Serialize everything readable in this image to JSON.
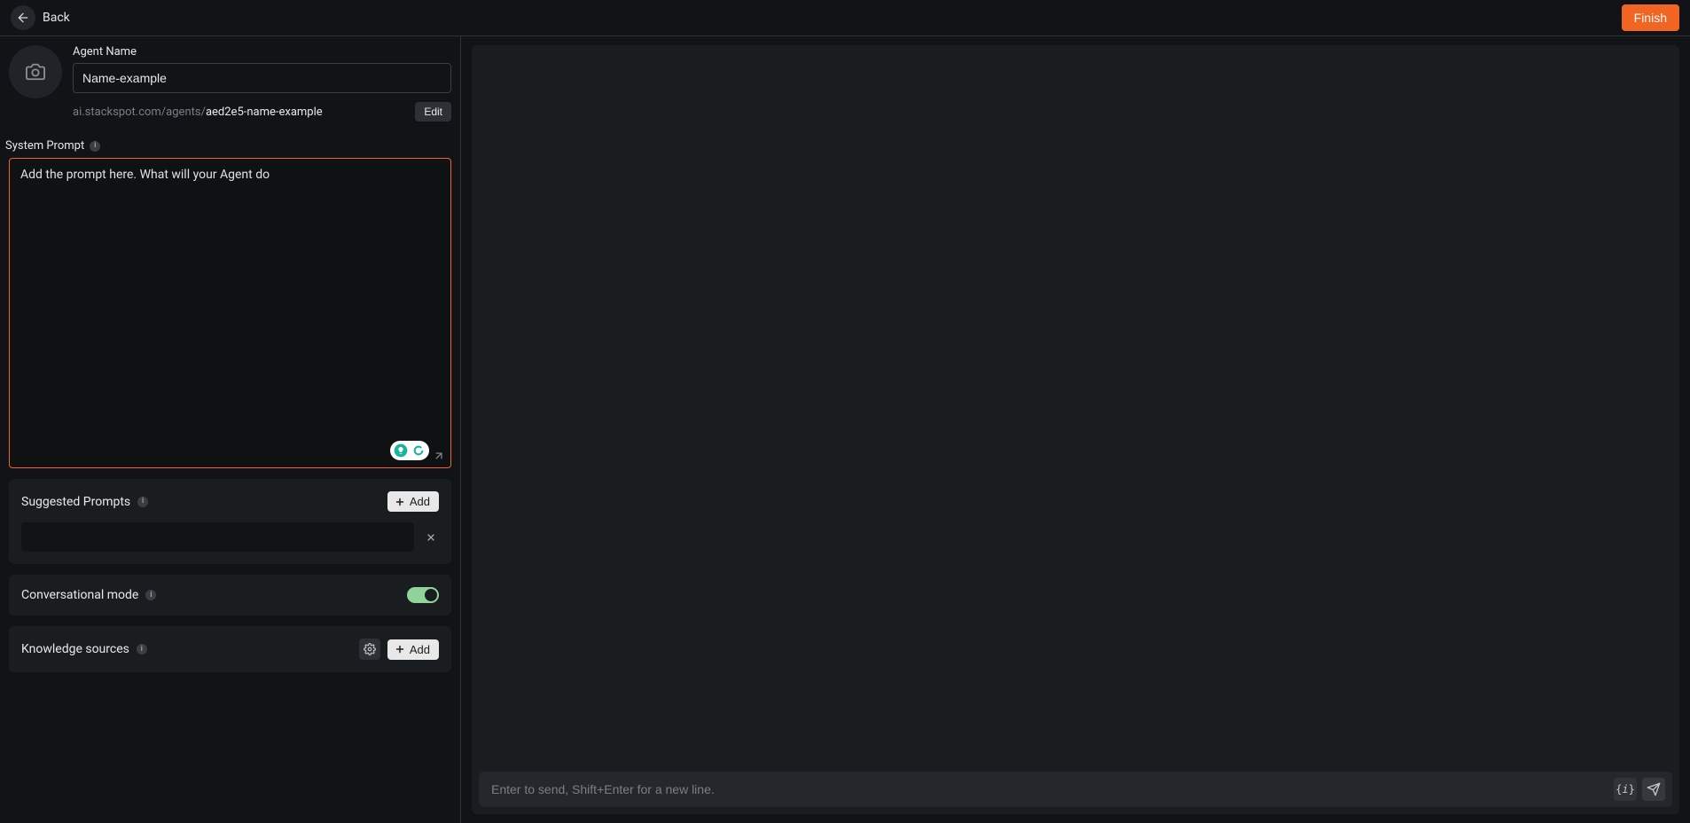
{
  "topbar": {
    "back_label": "Back",
    "finish_label": "Finish"
  },
  "agent": {
    "name_label": "Agent Name",
    "name_value": "Name-example",
    "url_prefix": "ai.stackspot.com/agents/",
    "url_slug": "aed2e5-name-example",
    "edit_label": "Edit"
  },
  "system_prompt": {
    "label": "System Prompt",
    "placeholder": "Add the prompt here. What will your Agent do",
    "value": ""
  },
  "suggested_prompts": {
    "label": "Suggested Prompts",
    "add_label": "Add",
    "items": [
      {
        "value": ""
      }
    ]
  },
  "conversational_mode": {
    "label": "Conversational mode",
    "enabled": true
  },
  "knowledge_sources": {
    "label": "Knowledge sources",
    "add_label": "Add"
  },
  "chat": {
    "input_placeholder": "Enter to send, Shift+Enter for a new line."
  },
  "icons": {
    "back": "arrow-left",
    "camera": "camera",
    "info": "i",
    "plus": "plus",
    "close": "x",
    "gear": "gear",
    "expand": "expand",
    "braces": "{i}",
    "send": "send",
    "grammarly_bulb": "bulb",
    "grammarly_g": "G"
  },
  "colors": {
    "accent": "#f16421",
    "toggle_on": "#8fd49a",
    "bg": "#111316",
    "panel": "#1a1d20"
  }
}
